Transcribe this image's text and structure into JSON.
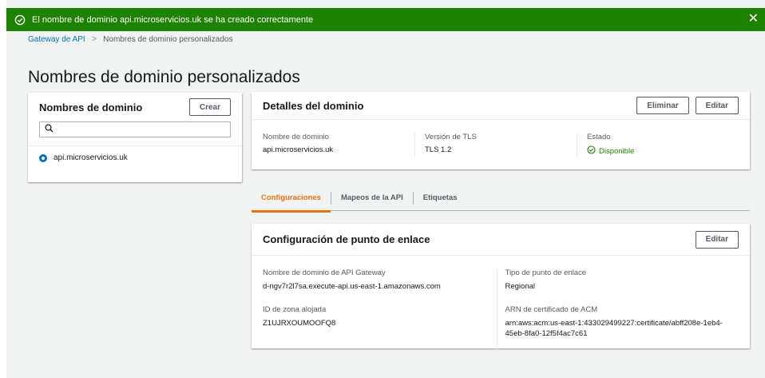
{
  "flash": {
    "message": "El nombre de dominio api.microservicios.uk se ha creado correctamente",
    "close": "✕",
    "color": "#1d8102"
  },
  "breadcrumb": {
    "root": "Gateway de API",
    "separator": ">",
    "current": "Nombres de dominio personalizados"
  },
  "page_title": "Nombres de dominio personalizados",
  "domain_list": {
    "title": "Nombres de dominio",
    "create_label": "Crear",
    "search_placeholder": "",
    "items": [
      {
        "label": "api.microservicios.uk",
        "selected": true
      }
    ]
  },
  "domain_details": {
    "title": "Detalles del dominio",
    "delete_label": "Eliminar",
    "edit_label": "Editar",
    "fields": [
      {
        "label": "Nombre de dominio",
        "value": "api.microservicios.uk"
      },
      {
        "label": "Versión de TLS",
        "value": "TLS 1.2"
      },
      {
        "label": "Estado",
        "value": "Disponible"
      }
    ]
  },
  "tabs": [
    {
      "label": "Configuraciones",
      "active": true
    },
    {
      "label": "Mapeos de la API",
      "active": false
    },
    {
      "label": "Etiquetas",
      "active": false
    }
  ],
  "endpoint_config": {
    "title": "Configuración de punto de enlace",
    "edit_label": "Editar",
    "left": [
      {
        "label": "Nombre de dominio de API Gateway",
        "value": "d-ngv7r2l7sa.execute-api.us-east-1.amazonaws.com"
      },
      {
        "label": "ID de zona alojada",
        "value": "Z1UJRXOUMOOFQ8"
      }
    ],
    "right": [
      {
        "label": "Tipo de punto de enlace",
        "value": "Regional"
      },
      {
        "label": "ARN de certificado de ACM",
        "value": "arn:aws:acm:us-east-1:433029499227:certificate/abff208e-1eb4-45eb-8fa0-12f5f4ac7c61"
      }
    ]
  },
  "colors": {
    "accent": "#ec7211",
    "link": "#0073bb",
    "success": "#1d8102"
  }
}
